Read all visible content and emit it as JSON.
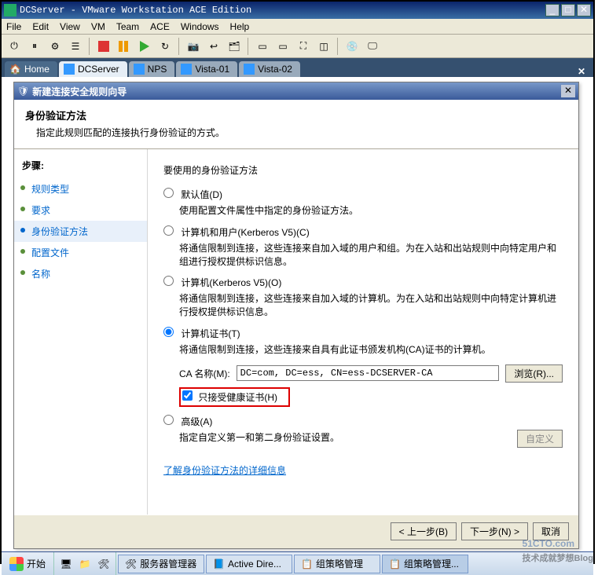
{
  "vmware": {
    "title": "DCServer - VMware Workstation ACE Edition",
    "menus": [
      "File",
      "Edit",
      "View",
      "VM",
      "Team",
      "ACE",
      "Windows",
      "Help"
    ],
    "tabs": {
      "home": "Home",
      "items": [
        "DCServer",
        "NPS",
        "Vista-01",
        "Vista-02"
      ],
      "activeIndex": 0
    }
  },
  "wizard": {
    "title": "新建连接安全规则向导",
    "headerTitle": "身份验证方法",
    "headerDesc": "指定此规则匹配的连接执行身份验证的方式。",
    "stepsTitle": "步骤:",
    "steps": [
      "规则类型",
      "要求",
      "身份验证方法",
      "配置文件",
      "名称"
    ],
    "currentStep": 2,
    "lead": "要使用的身份验证方法",
    "options": {
      "default": {
        "label": "默认值(D)",
        "desc": "使用配置文件属性中指定的身份验证方法。"
      },
      "compUser": {
        "label": "计算机和用户(Kerberos V5)(C)",
        "desc": "将通信限制到连接，这些连接来自加入域的用户和组。为在入站和出站规则中向特定用户和组进行授权提供标识信息。"
      },
      "comp": {
        "label": "计算机(Kerberos V5)(O)",
        "desc": "将通信限制到连接，这些连接来自加入域的计算机。为在入站和出站规则中向特定计算机进行授权提供标识信息。"
      },
      "cert": {
        "label": "计算机证书(T)",
        "desc": "将通信限制到连接，这些连接来自具有此证书颁发机构(CA)证书的计算机。"
      },
      "adv": {
        "label": "高级(A)",
        "desc": "指定自定义第一和第二身份验证设置。"
      }
    },
    "caLabel": "CA 名称(M):",
    "caValue": "DC=com, DC=ess, CN=ess-DCSERVER-CA",
    "browse": "浏览(R)...",
    "healthCert": "只接受健康证书(H)",
    "customize": "自定义",
    "learnMore": "了解身份验证方法的详细信息",
    "buttons": {
      "back": "< 上一步(B)",
      "next": "下一步(N) >",
      "cancel": "取消"
    }
  },
  "taskbar": {
    "start": "开始",
    "tasks": [
      "服务器管理器",
      "Active Dire...",
      "组策略管理",
      "组策略管理..."
    ]
  },
  "watermark": {
    "brand": "51CTO.com",
    "sub": "技术成就梦想Blog"
  }
}
